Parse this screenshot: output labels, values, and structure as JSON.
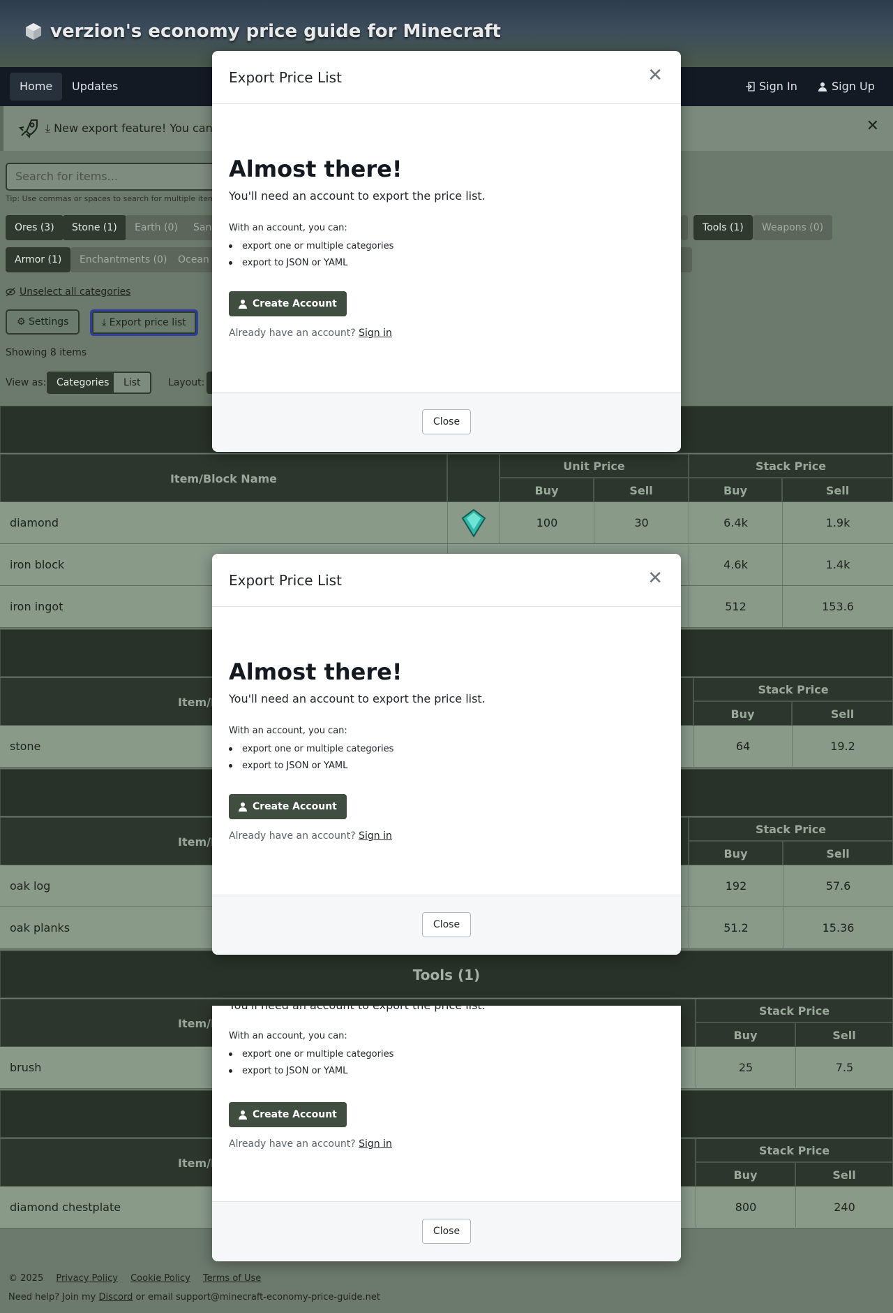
{
  "header": {
    "title": "verzion's economy price guide for Minecraft"
  },
  "nav": {
    "home": "Home",
    "updates": "Updates",
    "sign_in": "Sign In",
    "sign_up": "Sign Up"
  },
  "banner": {
    "text": "New export feature! You can no"
  },
  "search": {
    "placeholder": "Search for items...",
    "tip": "Tip: Use commas or spaces to search for multiple items"
  },
  "categories_row1": [
    "Ores (3)",
    "Stone (1)",
    "Earth (0)",
    "Sand",
    "Tools (1)",
    "Weapons (0)"
  ],
  "categories_row2": [
    "Armor (1)",
    "Enchantments (0)",
    "Ocean ("
  ],
  "controls": {
    "unselect": "Unselect all categories",
    "settings": "Settings",
    "export": "Export price list",
    "showing": "Showing 8 items",
    "view_as": "View as:",
    "view_categories": "Categories",
    "view_list": "List",
    "layout": "Layout:"
  },
  "table_headers": {
    "name": "Item/Block Name",
    "name_partial": "Item/B",
    "unit_price": "Unit Price",
    "stack_price": "Stack Price",
    "buy": "Buy",
    "sell": "Sell"
  },
  "ores_rows": [
    {
      "name": "diamond",
      "unit_buy": "100",
      "unit_sell": "30",
      "stack_buy": "6.4k",
      "stack_sell": "1.9k"
    },
    {
      "name": "iron block",
      "stack_buy": "4.6k",
      "stack_sell": "1.4k"
    },
    {
      "name": "iron ingot",
      "stack_buy": "512",
      "stack_sell": "153.6"
    }
  ],
  "stone_rows": [
    {
      "name": "stone",
      "stack_buy": "64",
      "stack_sell": "19.2"
    }
  ],
  "wood_rows": [
    {
      "name": "oak log",
      "stack_buy": "192",
      "stack_sell": "57.6"
    },
    {
      "name": "oak planks",
      "stack_buy": "51.2",
      "stack_sell": "15.36"
    }
  ],
  "tools": {
    "title": "Tools (1)",
    "rows": [
      {
        "name": "brush",
        "stack_buy": "25",
        "stack_sell": "7.5"
      }
    ]
  },
  "armor_rows": [
    {
      "name": "diamond chestplate",
      "stack_buy": "800",
      "stack_sell": "240"
    }
  ],
  "modal": {
    "title": "Export Price List",
    "heading": "Almost there!",
    "need": "You'll need an account to export the price list.",
    "with": "With an account, you can:",
    "features": [
      "export one or multiple categories",
      "export to JSON or YAML"
    ],
    "create": "Create Account",
    "already": "Already have an account?",
    "sign_in": "Sign in",
    "close": "Close"
  },
  "footer": {
    "copyright": "© 2025",
    "privacy": "Privacy Policy",
    "cookie": "Cookie Policy",
    "terms": "Terms of Use",
    "help_prefix": "Need help? Join my",
    "discord": "Discord",
    "help_suffix": "or email support@minecraft-economy-price-guide.net"
  }
}
